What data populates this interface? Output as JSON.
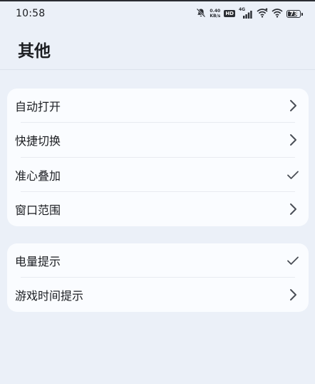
{
  "status_bar": {
    "time": "10:58",
    "net_speed_value": "0.40",
    "net_speed_unit": "KB/s",
    "hd_label": "HD",
    "network_type": "4G",
    "battery_level": "73"
  },
  "header": {
    "title": "其他"
  },
  "groups": [
    {
      "items": [
        {
          "label": "自动打开",
          "indicator": "chevron-right"
        },
        {
          "label": "快捷切换",
          "indicator": "chevron-right"
        },
        {
          "label": "准心叠加",
          "indicator": "checkmark"
        },
        {
          "label": "窗口范围",
          "indicator": "chevron-right"
        }
      ]
    },
    {
      "items": [
        {
          "label": "电量提示",
          "indicator": "checkmark"
        },
        {
          "label": "游戏时间提示",
          "indicator": "chevron-right"
        }
      ]
    }
  ],
  "colors": {
    "background": "#ebf0f8",
    "card": "#fafcff",
    "text": "#1b1d21",
    "icon": "#4a4e56"
  }
}
